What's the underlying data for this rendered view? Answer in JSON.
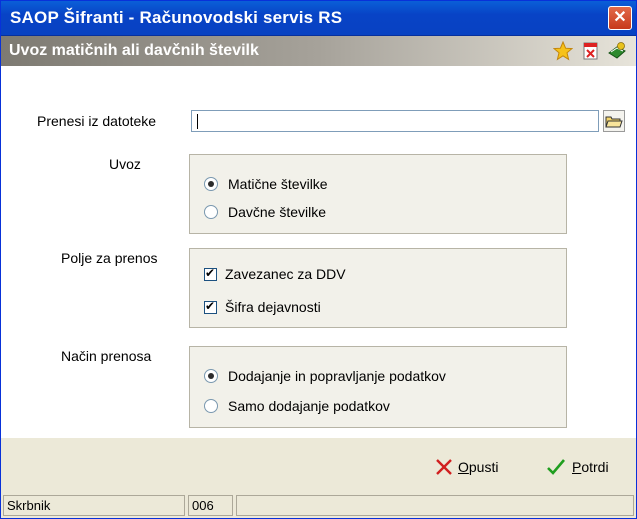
{
  "window": {
    "title": "SAOP Šifranti - Računovodski servis RS",
    "close_label": "✕"
  },
  "header": {
    "title": "Uvoz matičnih ali davčnih številk"
  },
  "form": {
    "file_label": "Prenesi iz datoteke",
    "file_value": "",
    "uvoz": {
      "label": "Uvoz",
      "options": [
        {
          "label": "Matične številke",
          "selected": true
        },
        {
          "label": "Davčne številke",
          "selected": false
        }
      ]
    },
    "polje": {
      "label": "Polje za prenos",
      "options": [
        {
          "label": "Zavezanec za DDV",
          "checked": true
        },
        {
          "label": "Šifra dejavnosti",
          "checked": true
        }
      ]
    },
    "nacin": {
      "label": "Način prenosa",
      "options": [
        {
          "label": "Dodajanje in popravljanje podatkov",
          "selected": true
        },
        {
          "label": "Samo dodajanje podatkov",
          "selected": false
        }
      ]
    }
  },
  "buttons": {
    "cancel": {
      "mnemonic": "O",
      "rest": "pusti"
    },
    "confirm": {
      "mnemonic": "P",
      "rest": "otrdi"
    }
  },
  "status": {
    "user": "Skrbnik",
    "code": "006",
    "extra": ""
  },
  "colors": {
    "titlebar": "#0a5fd8",
    "close": "#c7391b",
    "cancel_icon": "#d11f1f",
    "confirm_icon": "#1f9e1f"
  }
}
